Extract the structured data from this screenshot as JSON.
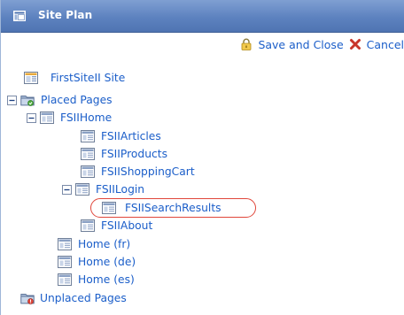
{
  "panel": {
    "title": "Site Plan",
    "title_icon": "site-plan-icon"
  },
  "toolbar": {
    "save_label": "Save and Close",
    "save_icon": "lock-icon",
    "cancel_label": "Cancel",
    "cancel_icon": "red-x-icon"
  },
  "tree": {
    "site": {
      "label": "FirstSiteII Site",
      "icon": "site-icon"
    },
    "placed": {
      "label": "Placed Pages",
      "icon": "folder-icon",
      "expanded": true
    },
    "fsiihome": {
      "label": "FSIIHome",
      "icon": "page-icon",
      "expanded": true
    },
    "articles": {
      "label": "FSIIArticles",
      "icon": "page-icon"
    },
    "products": {
      "label": "FSIIProducts",
      "icon": "page-icon"
    },
    "cart": {
      "label": "FSIIShoppingCart",
      "icon": "page-icon"
    },
    "login": {
      "label": "FSIILogin",
      "icon": "page-icon",
      "expanded": true
    },
    "search": {
      "label": "FSIISearchResults",
      "icon": "page-icon",
      "highlighted": true
    },
    "about": {
      "label": "FSIIAbout",
      "icon": "page-icon"
    },
    "home_fr": {
      "label": "Home (fr)",
      "icon": "page-icon"
    },
    "home_de": {
      "label": "Home (de)",
      "icon": "page-icon"
    },
    "home_es": {
      "label": "Home (es)",
      "icon": "page-icon"
    },
    "unplaced": {
      "label": "Unplaced Pages",
      "icon": "folder-alert-icon"
    }
  },
  "colors": {
    "link": "#1b5ec9",
    "title_bar": "#5d82bf",
    "highlight": "#e0463a"
  }
}
